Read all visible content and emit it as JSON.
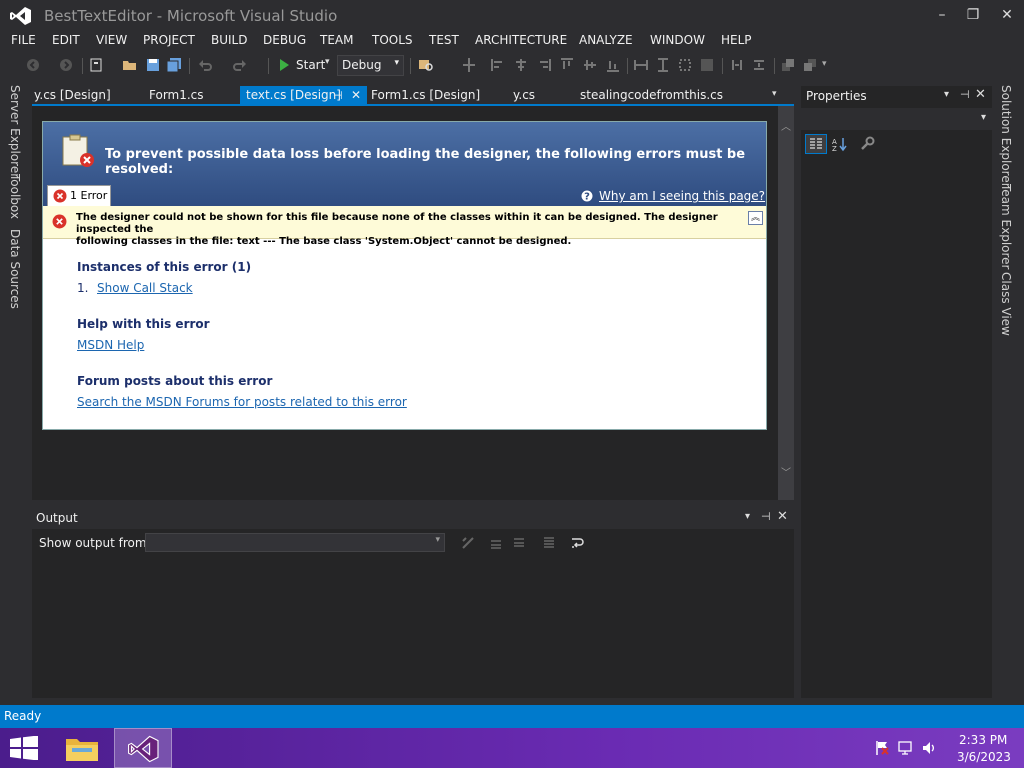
{
  "window": {
    "title": "BestTextEditor - Microsoft Visual Studio",
    "minimize": "–",
    "restore": "❐",
    "close": "✕"
  },
  "menu": [
    "FILE",
    "EDIT",
    "VIEW",
    "PROJECT",
    "BUILD",
    "DEBUG",
    "TEAM",
    "TOOLS",
    "TEST",
    "ARCHITECTURE",
    "ANALYZE",
    "WINDOW",
    "HELP"
  ],
  "toolbar": {
    "start_label": "Start",
    "config_value": "Debug"
  },
  "left_rail": [
    "Server Explorer",
    "Toolbox",
    "Data Sources"
  ],
  "right_rail": [
    "Solution Explorer",
    "Team Explorer",
    "Class View"
  ],
  "tabs": [
    {
      "label": "y.cs [Design]"
    },
    {
      "label": "Form1.cs"
    },
    {
      "label": "text.cs [Design]",
      "active": true
    },
    {
      "label": "Form1.cs [Design]"
    },
    {
      "label": "y.cs"
    },
    {
      "label": "stealingcodefromthis.cs"
    }
  ],
  "designer_error": {
    "banner": "To prevent possible data loss before loading the designer, the following errors must be resolved:",
    "error_count": "1 Error",
    "why_link": "Why am I seeing this page?",
    "message_line1": "The designer could not be shown for this file because none of the classes within it can be designed. The designer inspected the",
    "message_line2": "following classes in the file: text --- The base class 'System.Object' cannot be designed.",
    "instances_heading": "Instances of this error (1)",
    "instance_number": "1.",
    "show_call_stack": "Show Call Stack",
    "help_heading": "Help with this error",
    "msdn_help": "MSDN Help",
    "forum_heading": "Forum posts about this error",
    "forum_link": "Search the MSDN Forums for posts related to this error"
  },
  "output": {
    "title": "Output",
    "show_from_label": "Show output from:",
    "show_from_value": ""
  },
  "properties": {
    "title": "Properties"
  },
  "status": {
    "text": "Ready"
  },
  "taskbar": {
    "time": "2:33 PM",
    "date": "3/6/2023"
  },
  "colors": {
    "accent": "#007acc",
    "chrome": "#2d2d30",
    "taskbar": "#5a23a0"
  }
}
